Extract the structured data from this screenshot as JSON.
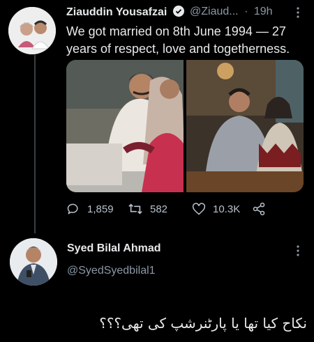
{
  "tweet": {
    "author_name": "Ziauddin Yousafzai",
    "author_handle": "@Ziaud...",
    "separator": "·",
    "time": "19h",
    "text": "We got married on 8th June 1994 — 27 years of respect, love and togetherness.",
    "replies": "1,859",
    "retweets": "582",
    "likes": "10.3K",
    "verified": true
  },
  "reply": {
    "author_name": "Syed Bilal Ahmad",
    "author_handle": "@SyedSyedbilal1",
    "text": "نکاح کیا تھا یا پارٹنرشپ کی تھی؟؟؟"
  },
  "icons": {
    "verified": "verified-badge-icon",
    "more": "more-vertical-icon",
    "reply": "reply-icon",
    "retweet": "retweet-icon",
    "like": "heart-icon",
    "share": "share-icon"
  },
  "colors": {
    "background": "#000000",
    "text": "#e7e9ea",
    "muted": "#8b98a5",
    "icon": "#b9c2cb"
  }
}
